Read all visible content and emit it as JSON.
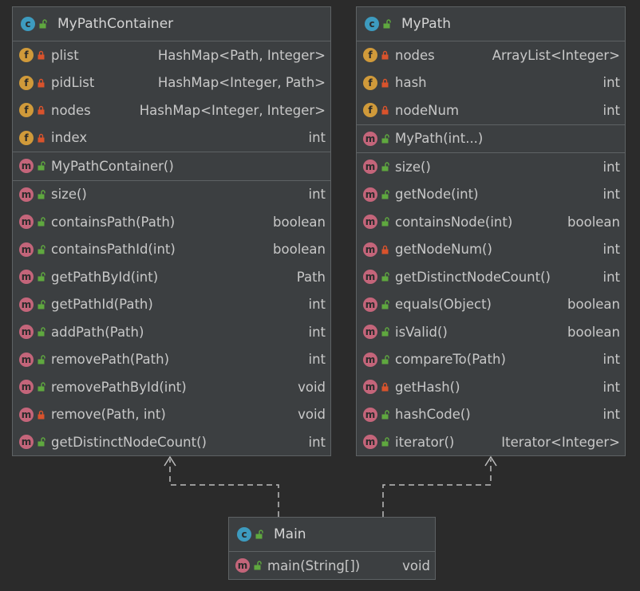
{
  "classes": {
    "container": {
      "name": "MyPathContainer",
      "fields": [
        {
          "name": "plist",
          "type": "HashMap<Path, Integer>",
          "visibility": "private"
        },
        {
          "name": "pidList",
          "type": "HashMap<Integer, Path>",
          "visibility": "private"
        },
        {
          "name": "nodes",
          "type": "HashMap<Integer, Integer>",
          "visibility": "private"
        },
        {
          "name": "index",
          "type": "int",
          "visibility": "private"
        }
      ],
      "constructors": [
        {
          "name": "MyPathContainer()",
          "type": "",
          "visibility": "public"
        }
      ],
      "methods": [
        {
          "name": "size()",
          "type": "int",
          "visibility": "public"
        },
        {
          "name": "containsPath(Path)",
          "type": "boolean",
          "visibility": "public"
        },
        {
          "name": "containsPathId(int)",
          "type": "boolean",
          "visibility": "public"
        },
        {
          "name": "getPathById(int)",
          "type": "Path",
          "visibility": "public"
        },
        {
          "name": "getPathId(Path)",
          "type": "int",
          "visibility": "public"
        },
        {
          "name": "addPath(Path)",
          "type": "int",
          "visibility": "public"
        },
        {
          "name": "removePath(Path)",
          "type": "int",
          "visibility": "public"
        },
        {
          "name": "removePathById(int)",
          "type": "void",
          "visibility": "public"
        },
        {
          "name": "remove(Path, int)",
          "type": "void",
          "visibility": "private"
        },
        {
          "name": "getDistinctNodeCount()",
          "type": "int",
          "visibility": "public"
        }
      ]
    },
    "path": {
      "name": "MyPath",
      "fields": [
        {
          "name": "nodes",
          "type": "ArrayList<Integer>",
          "visibility": "private"
        },
        {
          "name": "hash",
          "type": "int",
          "visibility": "private"
        },
        {
          "name": "nodeNum",
          "type": "int",
          "visibility": "private"
        }
      ],
      "constructors": [
        {
          "name": "MyPath(int...)",
          "type": "",
          "visibility": "public"
        }
      ],
      "methods": [
        {
          "name": "size()",
          "type": "int",
          "visibility": "public"
        },
        {
          "name": "getNode(int)",
          "type": "int",
          "visibility": "public"
        },
        {
          "name": "containsNode(int)",
          "type": "boolean",
          "visibility": "public"
        },
        {
          "name": "getNodeNum()",
          "type": "int",
          "visibility": "private"
        },
        {
          "name": "getDistinctNodeCount()",
          "type": "int",
          "visibility": "public"
        },
        {
          "name": "equals(Object)",
          "type": "boolean",
          "visibility": "public"
        },
        {
          "name": "isValid()",
          "type": "boolean",
          "visibility": "public"
        },
        {
          "name": "compareTo(Path)",
          "type": "int",
          "visibility": "public"
        },
        {
          "name": "getHash()",
          "type": "int",
          "visibility": "private"
        },
        {
          "name": "hashCode()",
          "type": "int",
          "visibility": "public"
        },
        {
          "name": "iterator()",
          "type": "Iterator<Integer>",
          "visibility": "public"
        }
      ]
    },
    "main": {
      "name": "Main",
      "fields": [],
      "constructors": [],
      "methods": [
        {
          "name": "main(String[])",
          "type": "void",
          "visibility": "public"
        }
      ]
    }
  },
  "badges": {
    "class": "c",
    "field": "f",
    "method": "m"
  },
  "colors": {
    "background": "#2b2b2b",
    "panel": "#3c3f41",
    "border": "#5e6264",
    "class_badge": "#3d9bbf",
    "field_badge": "#d09a3a",
    "method_badge": "#c4657a",
    "public_lock": "#5fa83f",
    "private_lock": "#d9532c",
    "edge": "#bdbdbd"
  },
  "edges": [
    {
      "from": "main",
      "to": "container",
      "style": "dashed",
      "arrow": "open"
    },
    {
      "from": "main",
      "to": "path",
      "style": "dashed",
      "arrow": "open"
    }
  ]
}
